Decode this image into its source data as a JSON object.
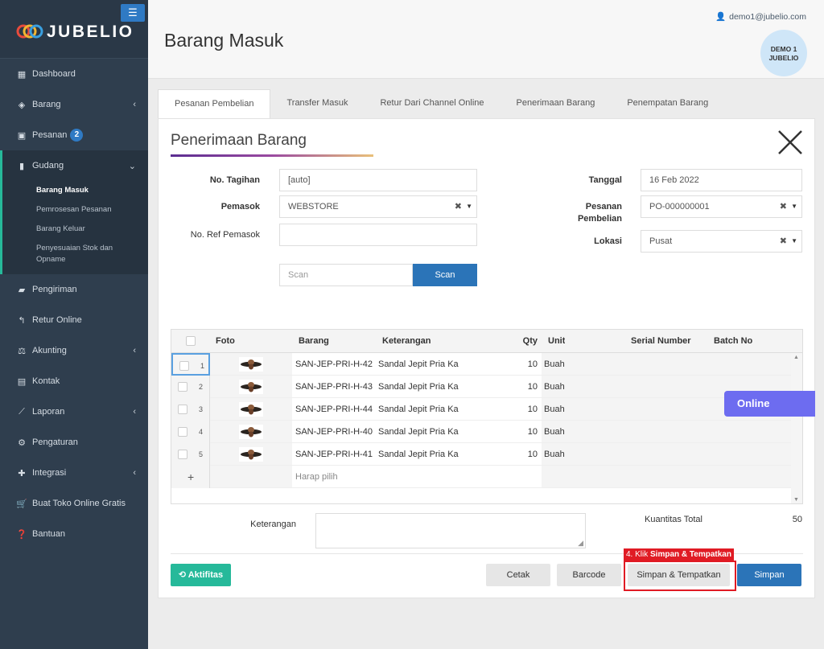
{
  "app": {
    "brand": "JUBELIO"
  },
  "sidebar": {
    "items": [
      {
        "label": "Dashboard",
        "icon": "chart-area-icon"
      },
      {
        "label": "Barang",
        "icon": "cubes-icon"
      },
      {
        "label": "Pesanan",
        "icon": "gift-icon",
        "badge": "2"
      },
      {
        "label": "Gudang",
        "icon": "building-icon"
      },
      {
        "label": "Pengiriman",
        "icon": "truck-icon"
      },
      {
        "label": "Retur Online",
        "icon": "reply-icon"
      },
      {
        "label": "Akunting",
        "icon": "balance-scale-icon"
      },
      {
        "label": "Kontak",
        "icon": "address-card-icon"
      },
      {
        "label": "Laporan",
        "icon": "line-chart-icon"
      },
      {
        "label": "Pengaturan",
        "icon": "cogs-icon"
      },
      {
        "label": "Integrasi",
        "icon": "puzzle-icon"
      },
      {
        "label": "Buat Toko Online Gratis",
        "icon": "cart-icon"
      },
      {
        "label": "Bantuan",
        "icon": "question-circle-icon"
      }
    ],
    "gudang_sub": [
      "Barang Masuk",
      "Pemrosesan Pesanan",
      "Barang Keluar",
      "Penyesuaian Stok dan Opname"
    ]
  },
  "header": {
    "title": "Barang Masuk",
    "email": "demo1@jubelio.com",
    "avatar_line1": "DEMO 1",
    "avatar_line2": "JUBELIO"
  },
  "tabs": [
    "Pesanan Pembelian",
    "Transfer Masuk",
    "Retur Dari Channel Online",
    "Penerimaan Barang",
    "Penempatan Barang"
  ],
  "form": {
    "title": "Penerimaan Barang",
    "no_tagihan_label": "No. Tagihan",
    "no_tagihan_value": "[auto]",
    "pemasok_label": "Pemasok",
    "pemasok_value": "WEBSTORE",
    "ref_label": "No. Ref Pemasok",
    "ref_value": "",
    "scan_placeholder": "Scan",
    "scan_button": "Scan",
    "tanggal_label": "Tanggal",
    "tanggal_value": "16 Feb 2022",
    "pesanan_label_1": "Pesanan",
    "pesanan_label_2": "Pembelian",
    "pesanan_value": "PO-000000001",
    "lokasi_label": "Lokasi",
    "lokasi_value": "Pusat"
  },
  "grid": {
    "headers": {
      "foto": "Foto",
      "barang": "Barang",
      "keterangan": "Keterangan",
      "qty": "Qty",
      "unit": "Unit",
      "serial": "Serial Number",
      "batch": "Batch No"
    },
    "rows": [
      {
        "no": "1",
        "barang": "SAN-JEP-PRI-H-42",
        "keterangan": "Sandal Jepit Pria Kas",
        "qty": "10",
        "unit": "Buah"
      },
      {
        "no": "2",
        "barang": "SAN-JEP-PRI-H-43",
        "keterangan": "Sandal Jepit Pria Kas",
        "qty": "10",
        "unit": "Buah"
      },
      {
        "no": "3",
        "barang": "SAN-JEP-PRI-H-44",
        "keterangan": "Sandal Jepit Pria Kas",
        "qty": "10",
        "unit": "Buah"
      },
      {
        "no": "4",
        "barang": "SAN-JEP-PRI-H-40",
        "keterangan": "Sandal Jepit Pria Kas",
        "qty": "10",
        "unit": "Buah"
      },
      {
        "no": "5",
        "barang": "SAN-JEP-PRI-H-41",
        "keterangan": "Sandal Jepit Pria Kas",
        "qty": "10",
        "unit": "Buah"
      }
    ],
    "add_symbol": "+",
    "add_placeholder": "Harap pilih"
  },
  "footer": {
    "keterangan_label": "Keterangan",
    "kuantitas_label": "Kuantitas Total",
    "kuantitas_value": "50",
    "aktifitas": "Aktifitas",
    "cetak": "Cetak",
    "barcode": "Barcode",
    "simpan_tempatkan": "Simpan & Tempatkan",
    "simpan": "Simpan"
  },
  "annotation": {
    "prefix": "4. Klik ",
    "emphasis": "Simpan & Tempatkan"
  },
  "online_tab": "Online",
  "colors": {
    "sidebar": "#2f3e4e",
    "accent_blue": "#2b74b8",
    "accent_green": "#26b99a",
    "annotation_red": "#e01b24",
    "online_purple": "#6d6cf0"
  }
}
